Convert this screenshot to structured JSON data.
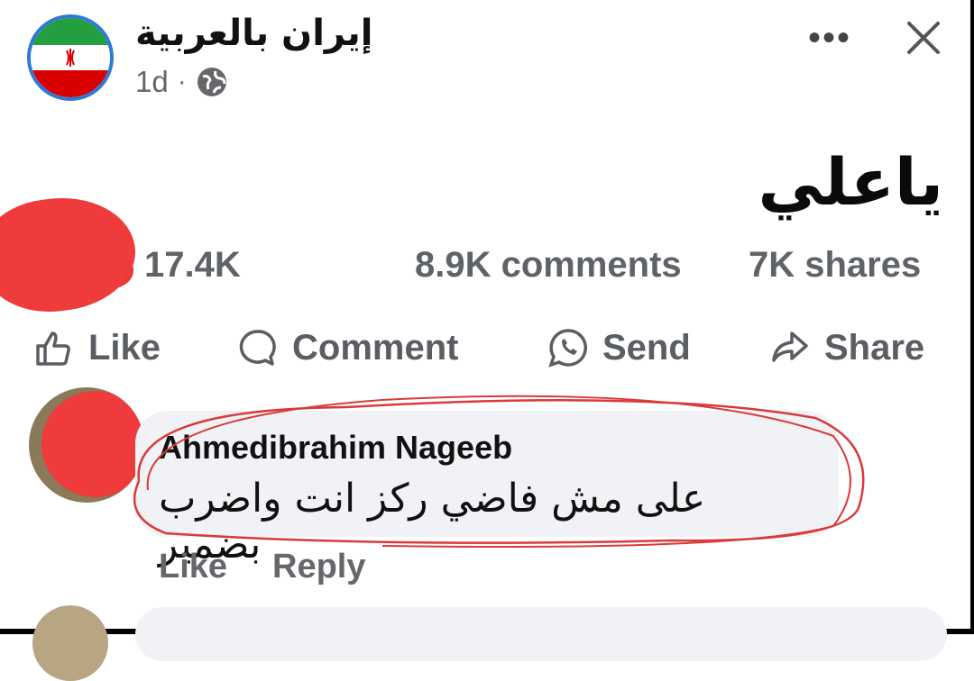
{
  "post": {
    "page_name": "إيران بالعربية",
    "time": "1d",
    "separator": "·",
    "privacy_icon": "globe-icon",
    "text": "ياعلي",
    "more_icon": "more-dots-icon",
    "close_icon": "close-icon"
  },
  "stats": {
    "reactions": "17.4K",
    "comments": "8.9K comments",
    "shares": "7K shares"
  },
  "actions": {
    "like": "Like",
    "comment": "Comment",
    "send": "Send",
    "share": "Share"
  },
  "comment": {
    "author": "Ahmedibrahim Nageeb",
    "text": "على مش فاضي ركز انت واضرب بضمير",
    "like": "Like",
    "reply": "Reply"
  },
  "colors": {
    "accent": "#2d7ad6",
    "redaction": "#ef3b3b",
    "annotation": "#d93a3a",
    "muted": "#65676b"
  }
}
